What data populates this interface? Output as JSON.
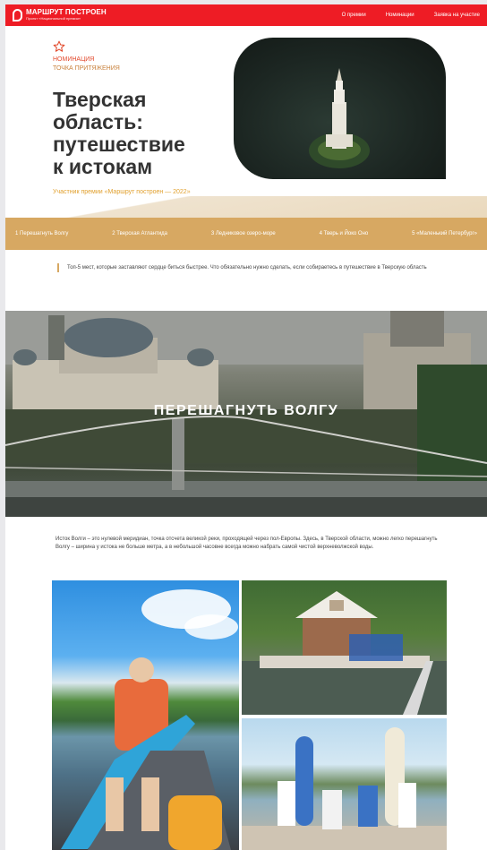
{
  "header": {
    "logo_title": "МАРШРУТ ПОСТРОЕН",
    "logo_subtitle": "Проект «Национальной премии»",
    "nav": [
      "О премии",
      "Номинации",
      "Заявка на участие"
    ]
  },
  "hero": {
    "nomination_label": "НОМИНАЦИЯ",
    "nomination_name": "ТОЧКА ПРИТЯЖЕНИЯ",
    "title_lines": [
      "Тверская",
      "область:",
      "путешествие",
      "к истокам"
    ],
    "participant": "Участник премии «Маршрут построен — 2022»",
    "photo_icon": "bell-tower-island-photo"
  },
  "menu": [
    "1 Перешагнуть Волгу",
    "2 Тверская Атлантида",
    "3 Ледниковое озеро-море",
    "4 Тверь и Йоко Оно",
    "5 «Маленький Петербург»"
  ],
  "intro": "Топ-5 мест, которые заставляют сердце биться быстрее. Что обязательно нужно сделать, если собираетесь в путешествие в Тверскую область",
  "section1": {
    "title": "ПЕРЕШАГНУТЬ ВОЛГУ",
    "text": "Исток Волги – это нулевой меридиан, точка отсчета великой реки, проходящей через пол-Европы. Здесь, в Тверской области, можно легко перешагнуть Волгу – ширина у истока не больше метра, а в небольшой часовне всегда можно набрать самой чистой верхневолжской воды."
  },
  "photos": [
    "kayak-river-photo",
    "chapel-on-water-photo",
    "sup-boards-group-photo"
  ],
  "colors": {
    "brand_red": "#ee1c25",
    "menu_gold": "#d7a862",
    "accent_orange": "#e24a2d"
  }
}
